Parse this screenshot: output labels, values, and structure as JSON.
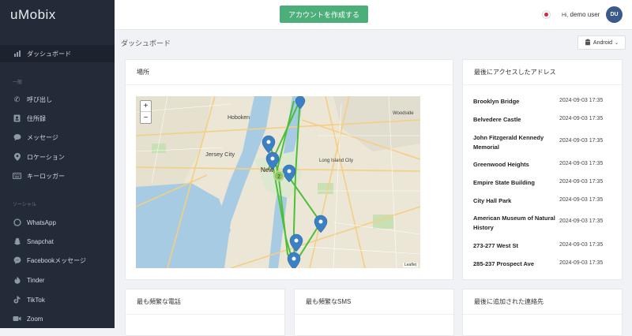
{
  "brand": {
    "logo": "uMobix"
  },
  "sidebar": {
    "dashboard": "ダッシュボード",
    "section_general": "一般",
    "general_items": [
      {
        "label": "呼び出し",
        "icon": "phone-icon"
      },
      {
        "label": "住所録",
        "icon": "contacts-icon"
      },
      {
        "label": "メッセージ",
        "icon": "message-icon"
      },
      {
        "label": "ロケーション",
        "icon": "location-icon"
      },
      {
        "label": "キーロッガー",
        "icon": "keyboard-icon"
      }
    ],
    "section_social": "ソーシャル",
    "social_items": [
      {
        "label": "WhatsApp",
        "icon": "whatsapp-icon"
      },
      {
        "label": "Snapchat",
        "icon": "snapchat-icon"
      },
      {
        "label": "Facebookメッセージ",
        "icon": "messenger-icon"
      },
      {
        "label": "Tinder",
        "icon": "tinder-icon"
      },
      {
        "label": "TikTok",
        "icon": "tiktok-icon"
      },
      {
        "label": "Zoom",
        "icon": "zoom-icon"
      }
    ]
  },
  "topbar": {
    "create_account": "アカウントを作成する",
    "greeting": "Hi,",
    "username": "demo user",
    "avatar_initials": "DU"
  },
  "page": {
    "title": "ダッシュボード",
    "os_label": "Android"
  },
  "location_card": {
    "title": "場所",
    "map_labels": [
      "Hoboken",
      "Jersey City",
      "New",
      "Woodside",
      "Long Island City"
    ],
    "cluster_count": "2",
    "zoom_in": "+",
    "zoom_out": "−",
    "attribution": "Leaflet"
  },
  "recent_addresses": {
    "title": "最後にアクセスしたアドレス",
    "rows": [
      {
        "name": "Brooklyn Bridge",
        "time": "2024-09-03 17:35"
      },
      {
        "name": "Belvedere Castle",
        "time": "2024-09-03 17:35"
      },
      {
        "name": "John Fitzgerald Kennedy Memorial",
        "time": "2024-09-03 17:35"
      },
      {
        "name": "Greenwood Heights",
        "time": "2024-09-03 17:35"
      },
      {
        "name": "Empire State Building",
        "time": "2024-09-03 17:35"
      },
      {
        "name": "City Hall Park",
        "time": "2024-09-03 17:35"
      },
      {
        "name": "American Museum of Natural History",
        "time": "2024-09-03 17:35"
      },
      {
        "name": "273-277 West St",
        "time": "2024-09-03 17:35"
      },
      {
        "name": "285-237 Prospect Ave",
        "time": "2024-09-03 17:35"
      }
    ]
  },
  "bottom_cards": {
    "calls": "最も頻繁な電話",
    "sms": "最も頻繁なSMS",
    "contacts": "最後に追加された連絡先"
  },
  "colors": {
    "accent": "#4caf7a",
    "sidebar": "#232a38",
    "marker": "#3b7fc4",
    "route": "#4cbf3a"
  }
}
